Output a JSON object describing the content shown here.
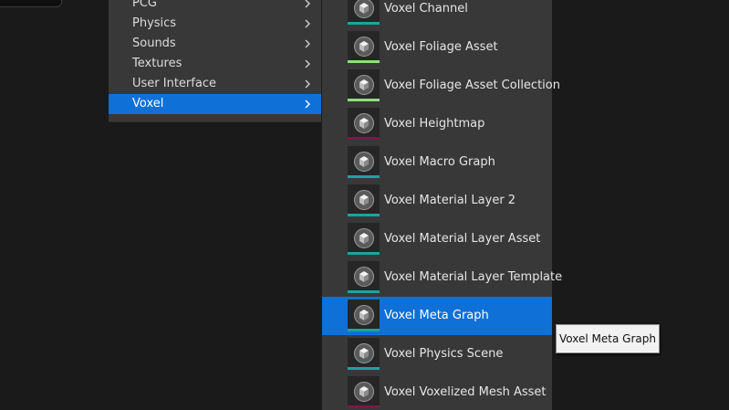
{
  "category_menu": {
    "items": [
      {
        "label": "PCG",
        "selected": false
      },
      {
        "label": "Physics",
        "selected": false
      },
      {
        "label": "Sounds",
        "selected": false
      },
      {
        "label": "Textures",
        "selected": false
      },
      {
        "label": "User Interface",
        "selected": false
      },
      {
        "label": "Voxel",
        "selected": true
      }
    ],
    "chevron_icon": "chevron-right-icon",
    "selected_color": "#0f70d7"
  },
  "asset_menu": {
    "items": [
      {
        "label": "Voxel Channel",
        "accent": "#1ca3a3",
        "selected": false
      },
      {
        "label": "Voxel Foliage Asset",
        "accent": "#8ce07a",
        "selected": false
      },
      {
        "label": "Voxel Foliage Asset Collection",
        "accent": "#8ce07a",
        "selected": false
      },
      {
        "label": "Voxel Heightmap",
        "accent": "#7a1848",
        "selected": false
      },
      {
        "label": "Voxel Macro Graph",
        "accent": "#1ca3a3",
        "selected": false
      },
      {
        "label": "Voxel Material Layer 2",
        "accent": "#1ca3a3",
        "selected": false
      },
      {
        "label": "Voxel Material Layer Asset",
        "accent": "#1ca3a3",
        "selected": false
      },
      {
        "label": "Voxel Material Layer Template",
        "accent": "#1ca3a3",
        "selected": false
      },
      {
        "label": "Voxel Meta Graph",
        "accent": "#1ca3a3",
        "selected": true
      },
      {
        "label": "Voxel Physics Scene",
        "accent": "#1ca3a3",
        "selected": false
      },
      {
        "label": "Voxel Voxelized Mesh Asset",
        "accent": "#7a1848",
        "selected": false
      }
    ],
    "thumbnail_icon": "voxel-asset-icon"
  },
  "tooltip": {
    "text": "Voxel Meta Graph"
  }
}
